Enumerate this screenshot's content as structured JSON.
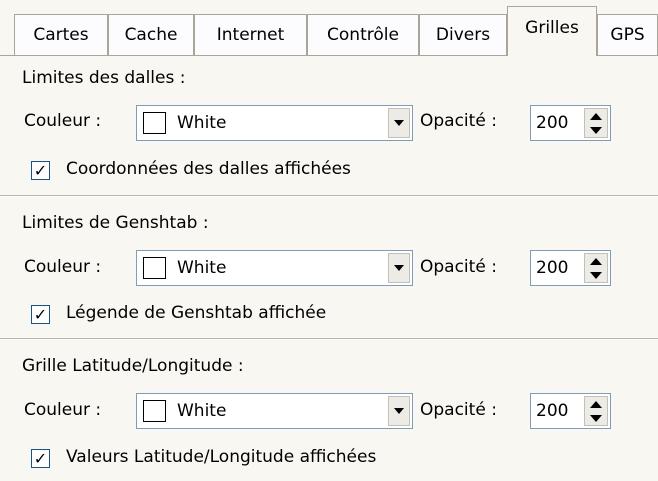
{
  "tabs": [
    {
      "label": "Cartes"
    },
    {
      "label": "Cache"
    },
    {
      "label": "Internet"
    },
    {
      "label": "Contrôle"
    },
    {
      "label": "Divers"
    },
    {
      "label": "Grilles",
      "active": true
    },
    {
      "label": "GPS"
    }
  ],
  "sections": [
    {
      "title": "Limites des dalles :",
      "couleur_label": "Couleur :",
      "couleur_value": "White",
      "opacite_label": "Opacité :",
      "opacite_value": "200",
      "checkbox_label": "Coordonnées des dalles affichées",
      "checked": true
    },
    {
      "title": "Limites de Genshtab :",
      "couleur_label": "Couleur :",
      "couleur_value": "White",
      "opacite_label": "Opacité :",
      "opacite_value": "200",
      "checkbox_label": "Légende de Genshtab affichée",
      "checked": true
    },
    {
      "title": "Grille Latitude/Longitude :",
      "couleur_label": "Couleur :",
      "couleur_value": "White",
      "opacite_label": "Opacité :",
      "opacite_value": "200",
      "checkbox_label": "Valeurs Latitude/Longitude affichées",
      "checked": true
    }
  ],
  "colors": {
    "background": "#f8f7f1",
    "swatch": "#ffffff",
    "border": "#7f9db9"
  },
  "icons": {
    "combo_arrow": "chevron-down-icon",
    "spin": "spinner-arrows-icon",
    "check": "checkmark-icon"
  }
}
